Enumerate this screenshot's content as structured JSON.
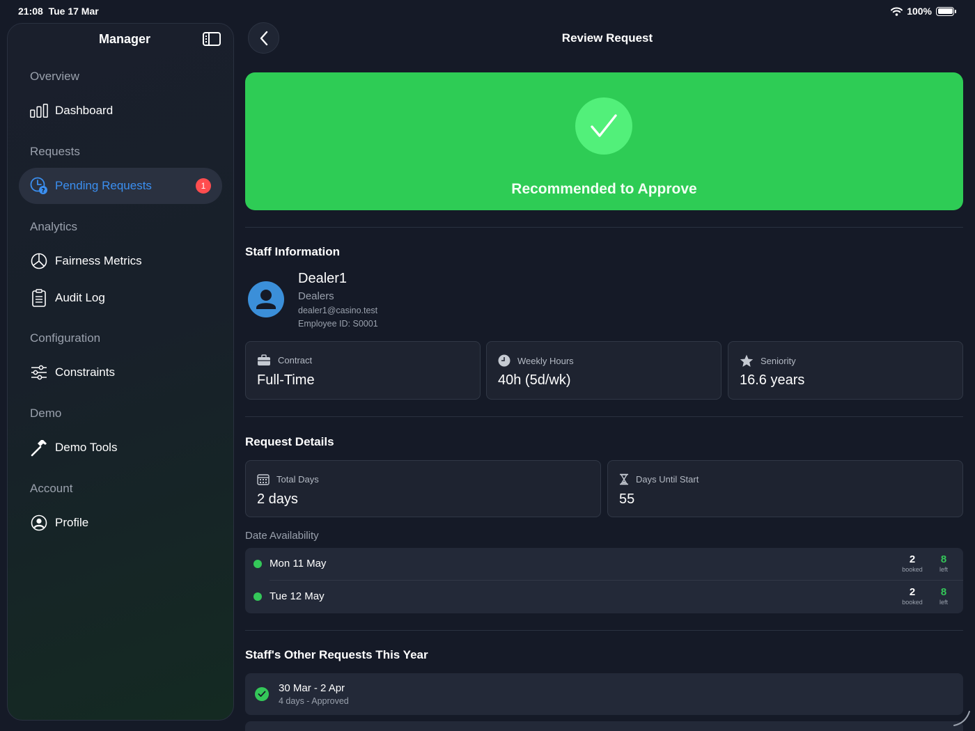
{
  "status": {
    "time": "21:08",
    "date": "Tue 17 Mar",
    "battery": "100%"
  },
  "sidebar": {
    "title": "Manager",
    "sections": {
      "overview": "Overview",
      "requests": "Requests",
      "analytics": "Analytics",
      "configuration": "Configuration",
      "demo": "Demo",
      "account": "Account"
    },
    "items": {
      "dashboard": "Dashboard",
      "pending": "Pending Requests",
      "pending_badge": "1",
      "fairness": "Fairness Metrics",
      "audit": "Audit Log",
      "constraints": "Constraints",
      "demo_tools": "Demo Tools",
      "profile": "Profile"
    }
  },
  "header": {
    "title": "Review Request"
  },
  "banner": {
    "text": "Recommended to Approve",
    "color": "#2ecc55"
  },
  "staff": {
    "section_title": "Staff Information",
    "name": "Dealer1",
    "department": "Dealers",
    "email": "dealer1@casino.test",
    "employee_id": "Employee ID: S0001",
    "cards": {
      "contract_label": "Contract",
      "contract_value": "Full-Time",
      "hours_label": "Weekly Hours",
      "hours_value": "40h (5d/wk)",
      "seniority_label": "Seniority",
      "seniority_value": "16.6 years"
    }
  },
  "request": {
    "section_title": "Request Details",
    "total_days_label": "Total Days",
    "total_days_value": "2 days",
    "until_start_label": "Days Until Start",
    "until_start_value": "55",
    "availability_label": "Date Availability",
    "dates": [
      {
        "date": "Mon 11 May",
        "booked": "2",
        "booked_label": "booked",
        "left": "8",
        "left_label": "left"
      },
      {
        "date": "Tue 12 May",
        "booked": "2",
        "booked_label": "booked",
        "left": "8",
        "left_label": "left"
      }
    ]
  },
  "other_requests": {
    "section_title": "Staff's Other Requests This Year",
    "items": [
      {
        "title": "30 Mar - 2 Apr",
        "subtitle": "4 days - Approved"
      }
    ]
  }
}
